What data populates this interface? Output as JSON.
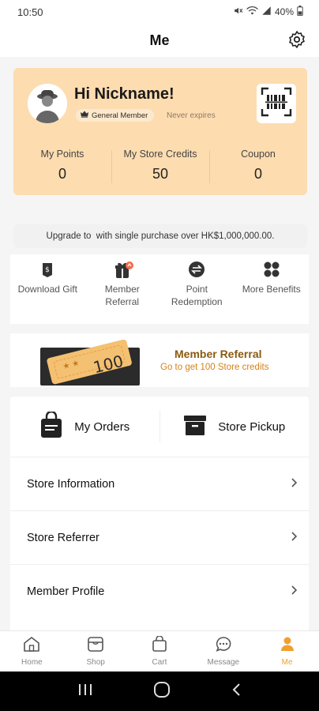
{
  "status": {
    "time": "10:50",
    "battery": "40%"
  },
  "header": {
    "title": "Me"
  },
  "member": {
    "greeting": "Hi Nickname!",
    "tier": "General Member",
    "expiry": "Never expires",
    "stats": [
      {
        "label": "My Points",
        "value": "0"
      },
      {
        "label": "My Store Credits",
        "value": "50"
      },
      {
        "label": "Coupon",
        "value": "0"
      }
    ]
  },
  "upgrade": {
    "text": "Upgrade to  with single purchase over HK$1,000,000.00."
  },
  "quick_links": [
    {
      "label": "Download Gift",
      "icon": "gift-tag-icon"
    },
    {
      "label": "Member Referral",
      "icon": "referral-gift-icon"
    },
    {
      "label": "Point Redemption",
      "icon": "exchange-icon"
    },
    {
      "label": "More Benefits",
      "icon": "grid-icon"
    }
  ],
  "referral_banner": {
    "voucher_amount": "100",
    "title": "Member Referral",
    "subtitle": "Go to get 100 Store credits"
  },
  "orders": {
    "my_orders": "My Orders",
    "store_pickup": "Store Pickup"
  },
  "menu": [
    {
      "label": "Store Information"
    },
    {
      "label": "Store Referrer"
    },
    {
      "label": "Member Profile"
    }
  ],
  "tabs": [
    {
      "label": "Home",
      "icon": "home-icon"
    },
    {
      "label": "Shop",
      "icon": "shop-icon"
    },
    {
      "label": "Cart",
      "icon": "cart-icon"
    },
    {
      "label": "Message",
      "icon": "message-icon"
    },
    {
      "label": "Me",
      "icon": "person-icon",
      "active": true
    }
  ],
  "colors": {
    "accent": "#f0a030",
    "card_bg": "#fddcb0",
    "referral_title": "#8a5a12",
    "referral_sub": "#d4821c"
  }
}
